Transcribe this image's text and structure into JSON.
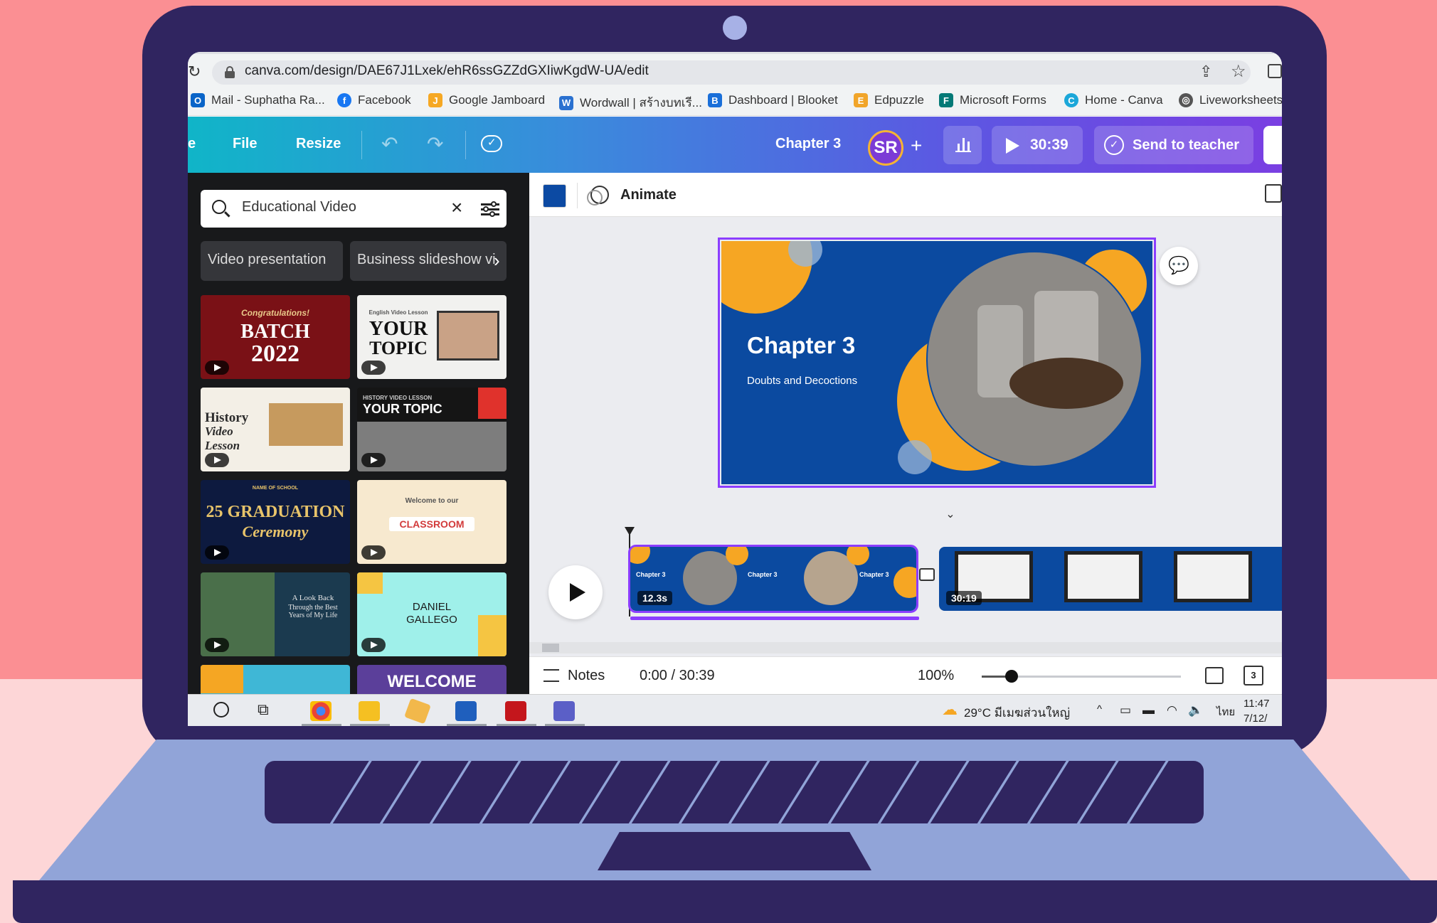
{
  "browser": {
    "url": "canva.com/design/DAE67J1Lxek/ehR6ssGZZdGXIiwKgdW-UA/edit",
    "bookmarks": [
      {
        "label": "Mail - Suphatha Ra...",
        "icon": "outlook-icon",
        "color": "#0a64c8"
      },
      {
        "label": "Facebook",
        "icon": "facebook-icon",
        "color": "#1877f2"
      },
      {
        "label": "Google Jamboard",
        "icon": "jamboard-icon",
        "color": "#f6a823"
      },
      {
        "label": "Wordwall | สร้างบทเรี...",
        "icon": "wordwall-icon",
        "color": "#2a71d0"
      },
      {
        "label": "Dashboard | Blooket",
        "icon": "blooket-icon",
        "color": "#1a6fd9"
      },
      {
        "label": "Edpuzzle",
        "icon": "edpuzzle-icon",
        "color": "#f1a52a"
      },
      {
        "label": "Microsoft Forms",
        "icon": "forms-icon",
        "color": "#047a77"
      },
      {
        "label": "Home - Canva",
        "icon": "canva-icon",
        "color": "#1ba7d9"
      },
      {
        "label": "Liveworksheets",
        "icon": "globe-icon",
        "color": "#555555"
      }
    ]
  },
  "header": {
    "menu_edge": "e",
    "file": "File",
    "resize": "Resize",
    "design_title": "Chapter 3",
    "avatar_initials": "SR",
    "present_time": "30:39",
    "send_label": "Send to teacher"
  },
  "left_panel": {
    "search_value": "Educational Video",
    "chips": [
      "Video presentation",
      "Business slideshow vi"
    ],
    "templates": [
      {
        "line1": "BATCH",
        "line2": "2022",
        "top": "Congratulations!",
        "bg": "#7a1116",
        "fg": "#ffffff"
      },
      {
        "line1": "YOUR",
        "line2": "TOPIC",
        "top": "English Video Lesson",
        "bg": "#f1f1ef",
        "fg": "#111111"
      },
      {
        "line1": "History",
        "line2": "Video Lesson",
        "top": "",
        "bg": "#f3efe6",
        "fg": "#2b2b2b"
      },
      {
        "line1": "YOUR TOPIC",
        "line2": "",
        "top": "HISTORY VIDEO LESSON",
        "bg": "#151515",
        "fg": "#ffffff"
      },
      {
        "line1": "25 GRADUATION",
        "line2": "Ceremony",
        "top": "NAME OF SCHOOL",
        "bg": "#0d1a3f",
        "fg": "#e8c46a"
      },
      {
        "line1": "CLASSROOM",
        "line2": "",
        "top": "Welcome to our",
        "bg": "#f7e9cf",
        "fg": "#d23a3a"
      },
      {
        "line1": "A Look Back",
        "line2": "Through the Best Years of My Life",
        "top": "",
        "bg": "#1b3a4f",
        "fg": "#e6e6e6"
      },
      {
        "line1": "DANIEL",
        "line2": "GALLEGO",
        "top": "",
        "bg": "#9ff0ea",
        "fg": "#1b1b1b"
      },
      {
        "line1": "",
        "line2": "",
        "top": "",
        "bg": "#3fb7d6",
        "fg": "#ffffff"
      },
      {
        "line1": "WELCOME",
        "line2": "",
        "top": "",
        "bg": "#5b3f9a",
        "fg": "#ffffff"
      }
    ]
  },
  "editor": {
    "animate": "Animate",
    "slide_title": "Chapter 3",
    "slide_subtitle": "Doubts and Decoctions",
    "clip1_duration": "12.3s",
    "clip1_label": "Chapter 3",
    "clip2_duration": "30:19",
    "notes": "Notes",
    "time": "0:00 / 30:39",
    "zoom": "100%",
    "zoom_level": 0.15,
    "pages_count": "3"
  },
  "taskbar": {
    "weather": "29°C มีเมฆส่วนใหญ่",
    "lang": "ไทย",
    "time": "11:47",
    "date": "7/12/"
  },
  "colors": {
    "canva_purple": "#8b3dff",
    "slide_blue": "#0b4aa0",
    "accent_orange": "#f6a623"
  }
}
